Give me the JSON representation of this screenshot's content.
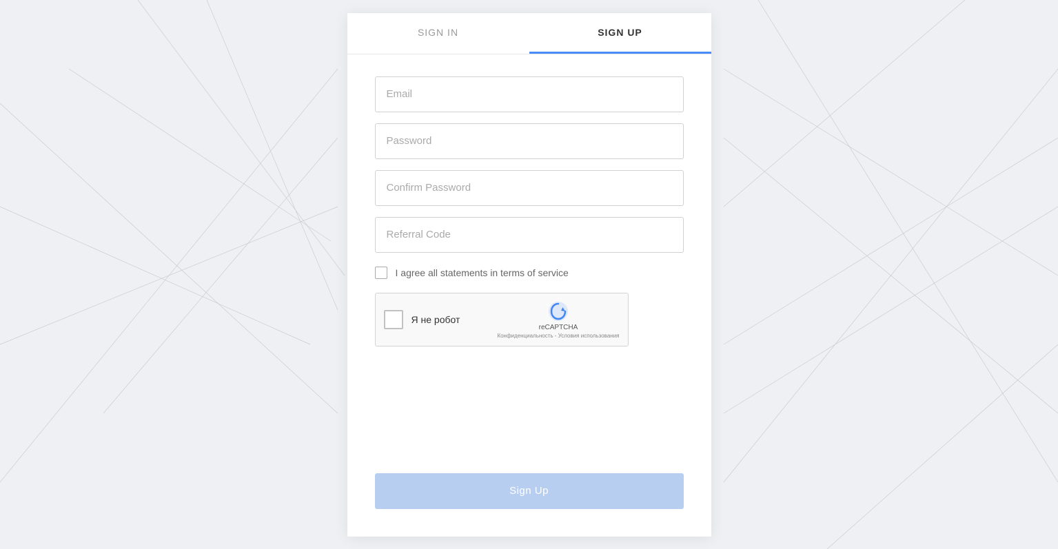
{
  "background": {
    "color": "#eef0f4"
  },
  "tabs": {
    "sign_in": {
      "label": "SIGN IN",
      "active": false
    },
    "sign_up": {
      "label": "SIGN UP",
      "active": true
    }
  },
  "form": {
    "email_placeholder": "Email",
    "password_placeholder": "Password",
    "confirm_password_placeholder": "Confirm Password",
    "referral_code_placeholder": "Referral Code",
    "terms_label": "I agree all statements in terms of service",
    "recaptcha_label": "Я не робот",
    "recaptcha_brand": "reCAPTCHA",
    "recaptcha_links": "Конфиденциальность - Условия использования",
    "submit_label": "Sign Up"
  }
}
